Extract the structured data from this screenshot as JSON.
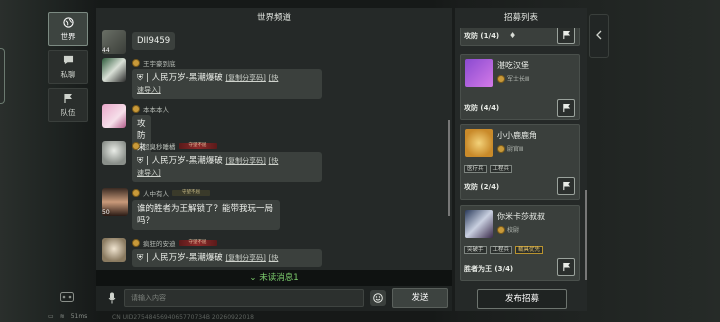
{
  "nav": {
    "items": [
      {
        "label": "世界",
        "icon": "globe-icon",
        "active": true
      },
      {
        "label": "私聊",
        "icon": "chat-bubble-icon",
        "active": false
      },
      {
        "label": "队伍",
        "icon": "flag-icon",
        "active": false
      }
    ]
  },
  "status": {
    "ping": "51ms"
  },
  "chat": {
    "title": "世界频道",
    "messages": [
      {
        "level": "44",
        "name": "",
        "text": "DII9459"
      },
      {
        "level": "",
        "name": "王宇豪到底",
        "share_prefix": "| 人民万岁-黑潮爆破",
        "share_link1": "[复制分享码]",
        "share_link2": "[快",
        "share_tail": "速导入]"
      },
      {
        "level": "",
        "name": "本本本人",
        "text": "攻防来"
      },
      {
        "level": "",
        "name": "超臭秒睡橘",
        "tag": "守望不屈",
        "share_prefix": "| 人民万岁-黑潮爆破",
        "share_link1": "[复制分享码]",
        "share_link2": "[快",
        "share_tail": "速导入]"
      },
      {
        "level": "50",
        "name": "人中有人",
        "tag": "守望不屈",
        "text_line1": "谁的胜者为王解锁了？能带我玩一局",
        "text_line2": "吗？"
      },
      {
        "level": "",
        "name": "疯狂的安迪",
        "tag": "守望不屈",
        "share_prefix": "| 人民万岁-黑潮爆破",
        "share_link1": "[复制分享码]",
        "share_link2": "[快"
      }
    ],
    "unread": "未读消息1",
    "input_placeholder": "请输入内容",
    "send_label": "发送"
  },
  "recruit": {
    "title": "招募列表",
    "cards": [
      {
        "mode": "攻防 (1/4)"
      },
      {
        "name": "湛吃汉堡",
        "rank": "军士长Ⅲ",
        "mode": "攻防 (4/4)"
      },
      {
        "name": "小小鹿鹿角",
        "rank": "尉官Ⅲ",
        "chips": [
          "医疗兵",
          "工程兵"
        ],
        "mode": "攻防 (2/4)"
      },
      {
        "name": "你米卡莎叔叔",
        "rank": "校尉",
        "chips": [
          "突破手",
          "工程兵",
          "载具优先"
        ],
        "mode": "胜者为王 (3/4)"
      }
    ],
    "publish_label": "发布招募"
  },
  "footer": {
    "uid": "CN UID2754845694065770734B 20260922018"
  }
}
